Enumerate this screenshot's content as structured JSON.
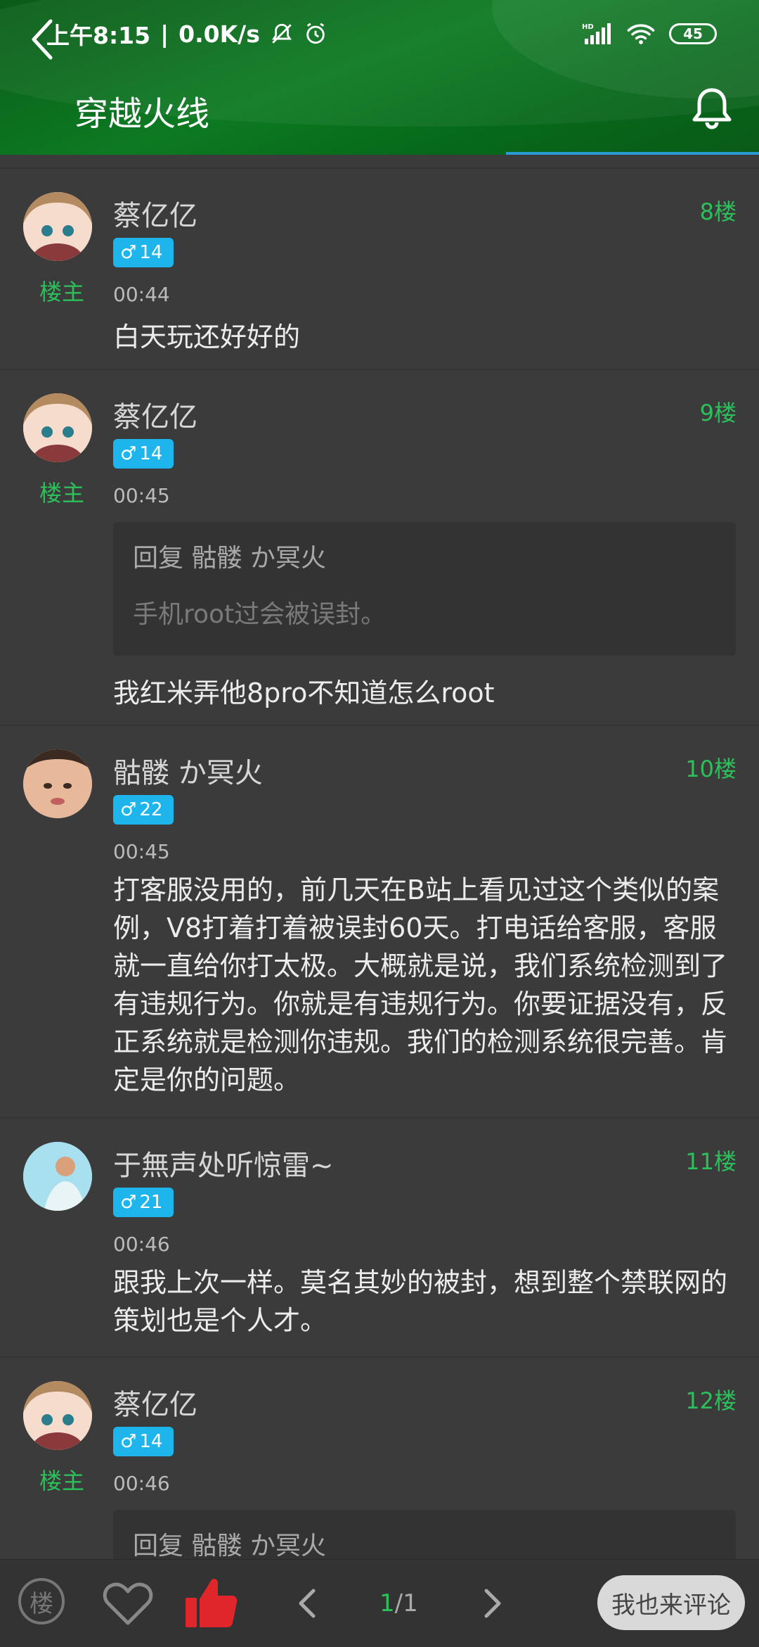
{
  "status": {
    "time": "上午8:15",
    "speed": "0.0K/s",
    "battery": "45",
    "network": "HD"
  },
  "header": {
    "title": "穿越火线"
  },
  "owner_label": "楼主",
  "posts": [
    {
      "username": "蔡亿亿",
      "floor": "8楼",
      "level": "14",
      "time": "00:44",
      "content": "白天玩还好好的",
      "is_owner": true
    },
    {
      "username": "蔡亿亿",
      "floor": "9楼",
      "level": "14",
      "time": "00:45",
      "quote_title": "回复 骷髅 か冥火",
      "quote_text": "手机root过会被误封。",
      "content": "我红米弄他8pro不知道怎么root",
      "is_owner": true
    },
    {
      "username": "骷髅 か冥火",
      "floor": "10楼",
      "level": "22",
      "time": "00:45",
      "content": "打客服没用的，前几天在B站上看见过这个类似的案例，V8打着打着被误封60天。打电话给客服，客服就一直给你打太极。大概就是说，我们系统检测到了有违规行为。你就是有违规行为。你要证据没有，反正系统就是检测你违规。我们的检测系统很完善。肯定是你的问题。",
      "is_owner": false
    },
    {
      "username": "于無声处听惊雷~",
      "floor": "11楼",
      "level": "21",
      "time": "00:46",
      "content": "跟我上次一样。莫名其妙的被封，想到整个禁联网的策划也是个人才。",
      "is_owner": false
    },
    {
      "username": "蔡亿亿",
      "floor": "12楼",
      "level": "14",
      "time": "00:46",
      "quote_title": "回复 骷髅 か冥火",
      "is_owner": true
    }
  ],
  "gender_symbol": "♂",
  "bottom": {
    "floor_button": "楼",
    "page_current": "1",
    "page_total": "/1",
    "comment_button": "我也来评论"
  },
  "colors": {
    "header_green": "#0d7a22",
    "accent_green": "#2cc05a",
    "badge_blue": "#1eb4ec",
    "thumb_red": "#e0262b",
    "background": "#3b3b3b"
  }
}
